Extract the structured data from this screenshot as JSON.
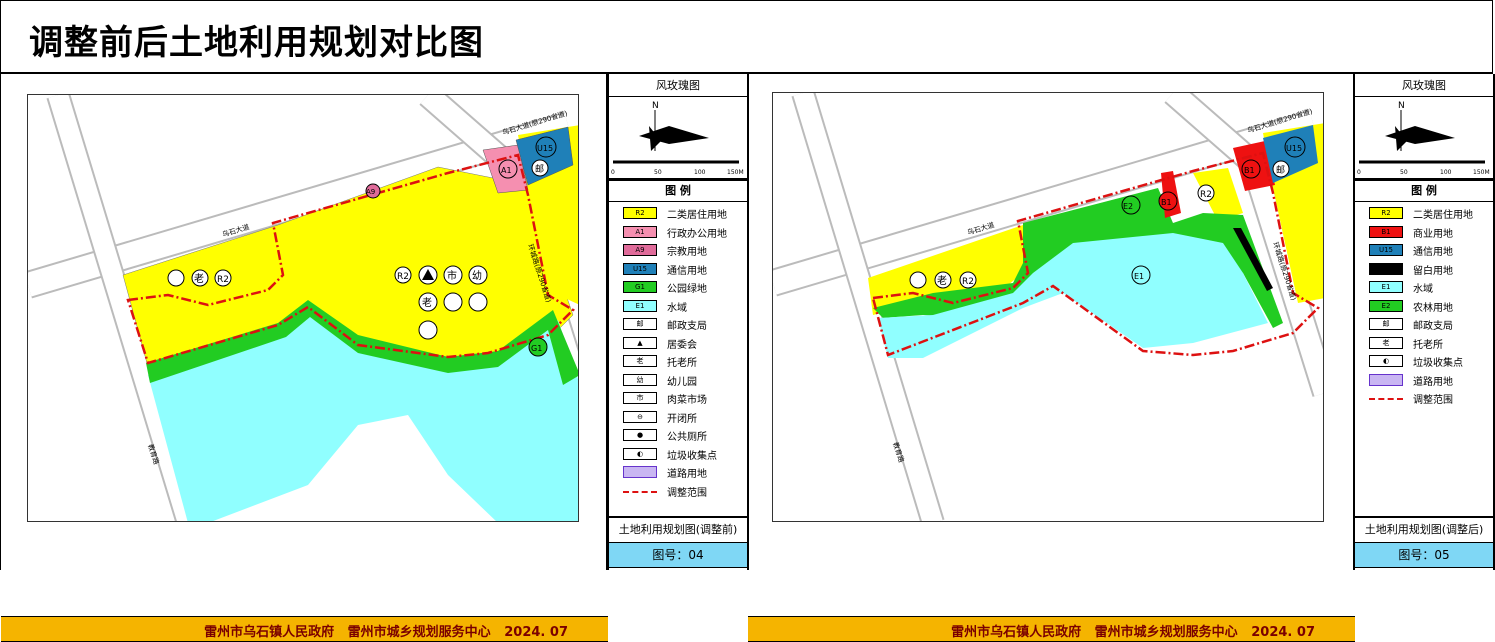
{
  "title": "调整前后土地利用规划对比图",
  "footer": {
    "issuer": "雷州市乌石镇人民政府   雷州市城乡规划服务中心   2024. 07"
  },
  "side_headers": {
    "compass_title": "风玫瑰图",
    "legend_title": "图  例",
    "north": "N",
    "scale_labels": [
      "0",
      "50",
      "100",
      "150M"
    ]
  },
  "before": {
    "map_name": "土地利用规划图(调整前)",
    "figure_no": "图号：04",
    "legend": [
      {
        "code": "R2",
        "label": "二类居住用地",
        "color": "#ffff00"
      },
      {
        "code": "A1",
        "label": "行政办公用地",
        "color": "#f58fb0"
      },
      {
        "code": "A9",
        "label": "宗教用地",
        "color": "#e06b9a"
      },
      {
        "code": "U15",
        "label": "通信用地",
        "color": "#1f80b8"
      },
      {
        "code": "G1",
        "label": "公园绿地",
        "color": "#22cc22"
      },
      {
        "code": "E1",
        "label": "水域",
        "color": "#90ffff"
      },
      {
        "code": "邮",
        "label": "邮政支局",
        "color": "#ffffff"
      },
      {
        "code": "▲",
        "label": "居委会",
        "color": "#ffffff"
      },
      {
        "code": "老",
        "label": "托老所",
        "color": "#ffffff"
      },
      {
        "code": "幼",
        "label": "幼儿园",
        "color": "#ffffff"
      },
      {
        "code": "市",
        "label": "肉菜市场",
        "color": "#ffffff"
      },
      {
        "code": "⊖",
        "label": "开闭所",
        "color": "#ffffff"
      },
      {
        "code": "●",
        "label": "公共厕所",
        "color": "#ffffff"
      },
      {
        "code": "◐",
        "label": "垃圾收集点",
        "color": "#ffffff"
      },
      {
        "code": "",
        "label": "道路用地",
        "color": "#c9b6f2"
      },
      {
        "code": "",
        "label": "调整范围",
        "color": "#ffffff"
      }
    ],
    "map_labels": {
      "road_1": "乌石大道",
      "road_2": "乌石大道(原290省道)",
      "road_3": "教育路",
      "road_4": "环城路(原290省道)",
      "parcel_r2_a": "R2",
      "parcel_r2_b": "R2",
      "a1": "A1",
      "a9": "A9",
      "u15": "U15",
      "post": "邮",
      "g1": "G1",
      "lao_a": "老",
      "lao_b": "老",
      "shi": "市",
      "you": "幼"
    }
  },
  "after": {
    "map_name": "土地利用规划图(调整后)",
    "figure_no": "图号：05",
    "legend": [
      {
        "code": "R2",
        "label": "二类居住用地",
        "color": "#ffff00"
      },
      {
        "code": "B1",
        "label": "商业用地",
        "color": "#ee1111"
      },
      {
        "code": "U15",
        "label": "通信用地",
        "color": "#1f80b8"
      },
      {
        "code": "",
        "label": "留白用地",
        "color": "#000000"
      },
      {
        "code": "E1",
        "label": "水域",
        "color": "#90ffff"
      },
      {
        "code": "E2",
        "label": "农林用地",
        "color": "#22cc22"
      },
      {
        "code": "邮",
        "label": "邮政支局",
        "color": "#ffffff"
      },
      {
        "code": "老",
        "label": "托老所",
        "color": "#ffffff"
      },
      {
        "code": "◐",
        "label": "垃圾收集点",
        "color": "#ffffff"
      },
      {
        "code": "",
        "label": "道路用地",
        "color": "#c9b6f2"
      },
      {
        "code": "",
        "label": "调整范围",
        "color": "#ffffff"
      }
    ],
    "map_labels": {
      "road_1": "乌石大道",
      "road_2": "乌石大道(原290省道)",
      "road_3": "教育路",
      "road_4": "环城路(原290省道)",
      "parcel_r2_a": "R2",
      "parcel_r2_b": "R2",
      "b1_a": "B1",
      "b1_b": "B1",
      "u15": "U15",
      "post": "邮",
      "e1": "E1",
      "e2": "E2",
      "lao": "老"
    }
  },
  "colors": {
    "residential": "#ffff00",
    "water": "#90ffff",
    "green": "#22cc22",
    "boundary": "#dd1111",
    "footer_bg": "#f5b400",
    "footer_text": "#7a0000",
    "figure_no_bg": "#7fd7f5"
  }
}
